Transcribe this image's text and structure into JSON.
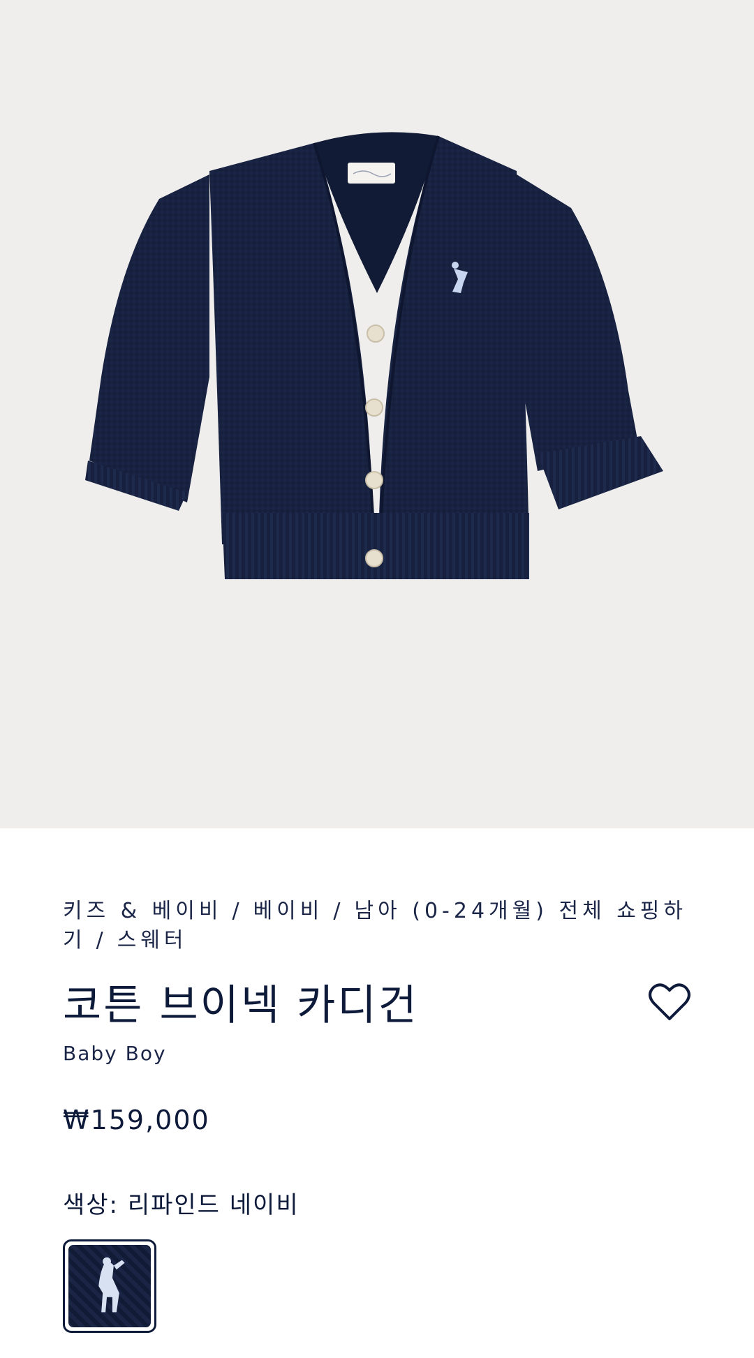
{
  "product": {
    "image_alt": "코튼 브이넥 카디건",
    "brand_label_icon": "ralph-lauren-label-icon",
    "pony_icon": "polo-pony-icon"
  },
  "breadcrumb": {
    "items": [
      "키즈 & 베이비",
      "베이비",
      "남아 (0-24개월) 전체 쇼핑하기",
      "스웨터"
    ],
    "separator": "/"
  },
  "title": "코튼 브이넥 카디건",
  "subtitle": "Baby Boy",
  "price": "₩159,000",
  "color": {
    "label": "색상:",
    "value": "리파인드 네이비",
    "swatch_hex": "#1a2444"
  },
  "wishlist_icon": "heart-icon",
  "colors": {
    "text": "#0e1a3a",
    "hero_bg": "#efeeec",
    "navy": "#18223f"
  }
}
